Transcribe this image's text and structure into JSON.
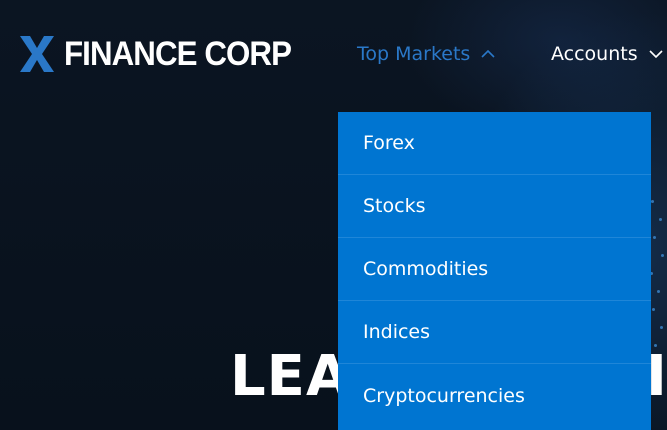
{
  "brand": {
    "logo_letter": "X",
    "name": "FINANCE CORP"
  },
  "nav": {
    "top_markets": {
      "label": "Top Markets",
      "expanded": true
    },
    "accounts": {
      "label": "Accounts",
      "expanded": false
    }
  },
  "dropdown": {
    "items": [
      {
        "label": "Forex"
      },
      {
        "label": "Stocks"
      },
      {
        "label": "Commodities"
      },
      {
        "label": "Indices"
      },
      {
        "label": "Cryptocurrencies"
      }
    ]
  },
  "hero": {
    "heading_visible_left": "LEA",
    "heading_visible_right": "I"
  },
  "colors": {
    "background": "#0a1320",
    "logo_accent": "#2a78c8",
    "nav_active": "#2a78c8",
    "nav_text": "#ffffff",
    "dropdown_bg": "#0075d1",
    "dropdown_divider": "#1f86d8"
  },
  "icons": {
    "top_markets_chevron": "chevron-up-icon",
    "accounts_chevron": "chevron-down-icon"
  }
}
